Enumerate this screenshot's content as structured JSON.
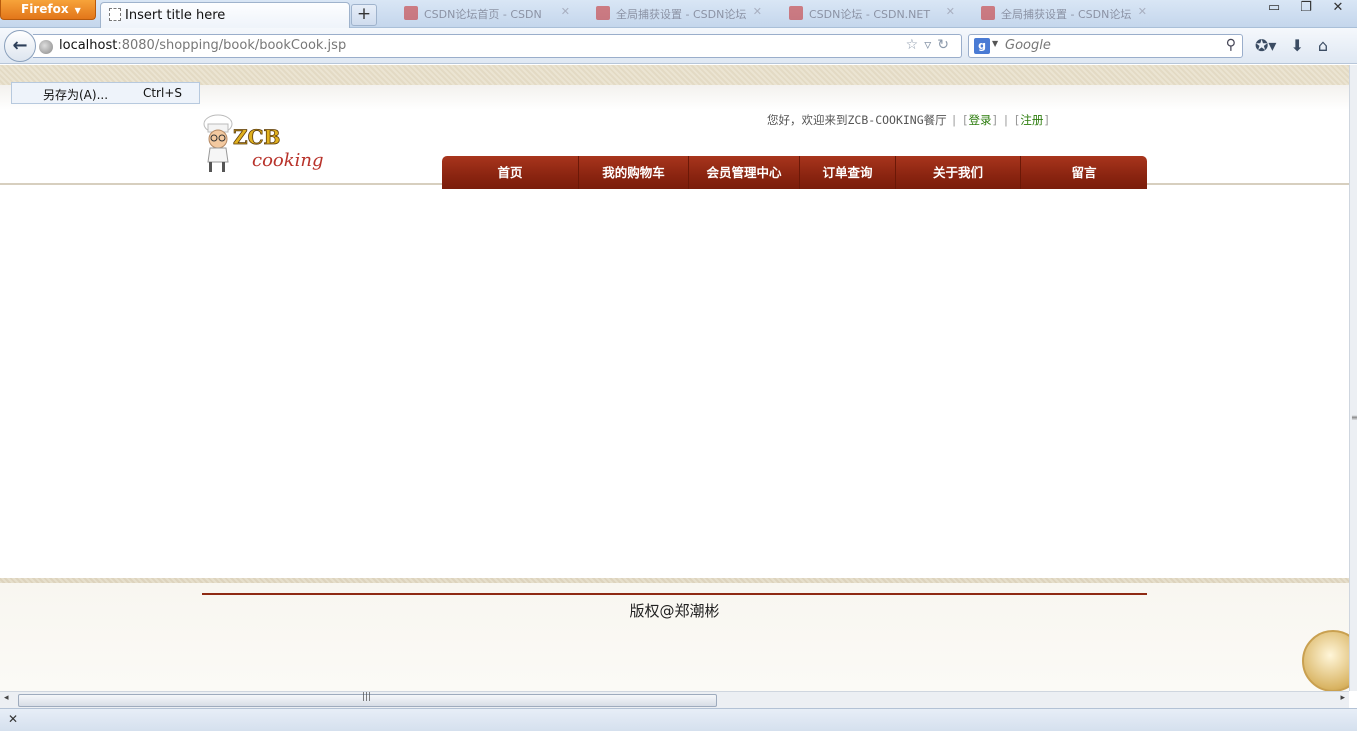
{
  "browser": {
    "app_button": "Firefox",
    "active_tab_title": "Insert title here",
    "new_tab_label": "+",
    "background_tabs": [
      "CSDN论坛首页 - CSDN",
      "全局捕获设置 - CSDN论坛",
      "CSDN论坛 - CSDN.NET",
      "全局捕获设置 - CSDN论坛"
    ],
    "url_host": "localhost",
    "url_path": ":8080/shopping/book/bookCook.jsp",
    "search_placeholder": "Google",
    "search_engine_letter": "g"
  },
  "context_menu": {
    "label": "另存为(A)...",
    "shortcut": "Ctrl+S"
  },
  "header": {
    "logo_text": "ZCB",
    "logo_subtext": "cooking",
    "welcome_text": "您好，欢迎来到ZCB-COOKING餐厅",
    "login_label": "登录",
    "register_label": "注册"
  },
  "nav": {
    "items": [
      "首页",
      "我的购物车",
      "会员管理中心",
      "订单查询",
      "关于我们",
      "留言"
    ]
  },
  "footer": {
    "copyright": "版权@郑潮彬"
  },
  "colors": {
    "nav_bg": "#8a2410",
    "link_green": "#2d7d0e",
    "footer_line": "#8e2a13"
  }
}
